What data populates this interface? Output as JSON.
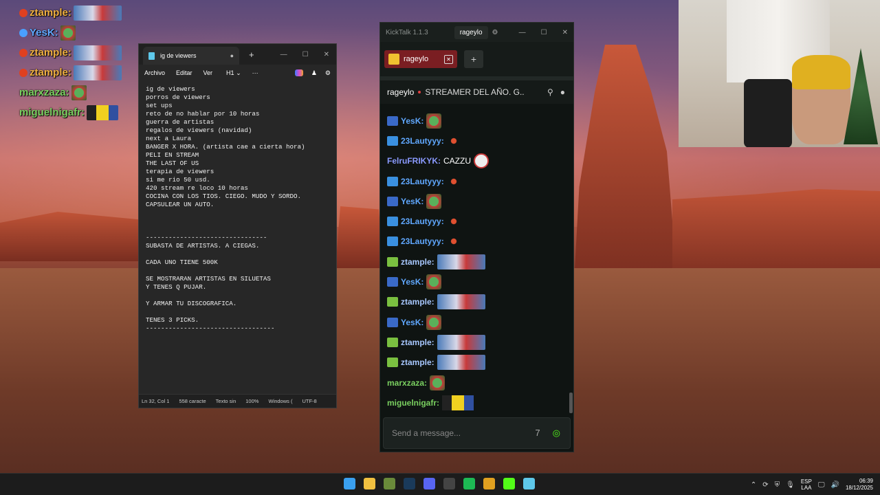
{
  "overlay_chat": [
    {
      "name": "ztample:",
      "color": "#f0b040",
      "badge": "#e04020",
      "emote": "wide"
    },
    {
      "name": "YesK:",
      "color": "#60a8ff",
      "badge": "#4aa0ff",
      "emote": "small"
    },
    {
      "name": "ztample:",
      "color": "#f0b040",
      "badge": "#e04020",
      "emote": "wide"
    },
    {
      "name": "ztample:",
      "color": "#f0b040",
      "badge": "#e04020",
      "emote": "wide"
    },
    {
      "name": "marxzaza:",
      "color": "#7ad060",
      "badge": "",
      "emote": "small"
    },
    {
      "name": "miguelnigafr:",
      "color": "#7ad060",
      "badge": "",
      "emote": "minion"
    }
  ],
  "notepad": {
    "tab_title": "ig de viewers",
    "menu": [
      "Archivo",
      "Editar",
      "Ver"
    ],
    "heading_select": "H1",
    "more": "···",
    "content": "ig de viewers\nporros de viewers\nset ups\nreto de no hablar por 10 horas\nguerra de artistas\nregalos de viewers (navidad)\nnext a Laura\nBANGER X HORA. (artista cae a cierta hora)\nPELI EN STREAM\nTHE LAST OF US\nterapia de viewers\nsi me rio 50 usd.\n420 stream re loco 10 horas\nCOCINA CON LOS TIOS. CIEGO. MUDO Y SORDO.\nCAPSULEAR UN AUTO.\n\n\n\n--------------------------------\nSUBASTA DE ARTISTAS. A CIEGAS.\n\nCADA UNO TIENE 500K\n\nSE MOSTRARAN ARTISTAS EN SILUETAS\nY TENES Q PUJAR.\n\nY ARMAR TU DISCOGRAFICA.\n\nTENES 3 PICKS.\n----------------------------------",
    "status": {
      "position": "Ln 32, Col 1",
      "chars": "558 caracte",
      "format": "Texto sin",
      "zoom": "100%",
      "eol": "Windows (",
      "encoding": "UTF-8"
    }
  },
  "kicktalk": {
    "app_title": "KickTalk 1.1.3",
    "user": "rageylo",
    "tab_label": "rageylo",
    "stream_channel": "rageylo",
    "stream_title": "STREAMER DEL AÑO. G...",
    "input_placeholder": "Send a message...",
    "messages": [
      {
        "name": "YesK:",
        "color": "#60a8ff",
        "badge": "#3a6ac8",
        "text": "",
        "emote": "pepe"
      },
      {
        "name": "23Lautyyy:",
        "color": "#60a8ff",
        "badge": "#3a90e0",
        "text": "",
        "emote": "dot"
      },
      {
        "name": "FelruFRIKYK:",
        "color": "#8a9aff",
        "badge": "",
        "text": "CAZZU",
        "emote": "ghost"
      },
      {
        "name": "23Lautyyy:",
        "color": "#60a8ff",
        "badge": "#3a90e0",
        "text": "",
        "emote": "dot"
      },
      {
        "name": "YesK:",
        "color": "#60a8ff",
        "badge": "#3a6ac8",
        "text": "",
        "emote": "pepe"
      },
      {
        "name": "23Lautyyy:",
        "color": "#60a8ff",
        "badge": "#3a90e0",
        "text": "",
        "emote": "dot"
      },
      {
        "name": "23Lautyyy:",
        "color": "#60a8ff",
        "badge": "#3a90e0",
        "text": "",
        "emote": "dot"
      },
      {
        "name": "ztample:",
        "color": "#a8c8ff",
        "badge": "#7ac040",
        "text": "",
        "emote": "wide"
      },
      {
        "name": "YesK:",
        "color": "#60a8ff",
        "badge": "#3a6ac8",
        "text": "",
        "emote": "pepe"
      },
      {
        "name": "ztample:",
        "color": "#a8c8ff",
        "badge": "#7ac040",
        "text": "",
        "emote": "wide"
      },
      {
        "name": "YesK:",
        "color": "#60a8ff",
        "badge": "#3a6ac8",
        "text": "",
        "emote": "pepe"
      },
      {
        "name": "ztample:",
        "color": "#a8c8ff",
        "badge": "#7ac040",
        "text": "",
        "emote": "wide"
      },
      {
        "name": "ztample:",
        "color": "#a8c8ff",
        "badge": "#7ac040",
        "text": "",
        "emote": "wide"
      },
      {
        "name": "marxzaza:",
        "color": "#7ad060",
        "badge": "",
        "text": "",
        "emote": "pepe"
      },
      {
        "name": "miguelnigafr:",
        "color": "#7ad060",
        "badge": "",
        "text": "",
        "emote": "minion"
      }
    ]
  },
  "taskbar": {
    "lang_top": "ESP",
    "lang_bottom": "LAA",
    "time": "06:39",
    "date": "18/12/2025",
    "apps": [
      {
        "name": "start-icon",
        "color": "#3aa0f0"
      },
      {
        "name": "file-explorer-icon",
        "color": "#f0c040"
      },
      {
        "name": "gamepad-app-icon",
        "color": "#6a8a3a"
      },
      {
        "name": "steam-icon",
        "color": "#1a3a5a"
      },
      {
        "name": "discord-icon",
        "color": "#5865f2"
      },
      {
        "name": "obs-icon",
        "color": "#444"
      },
      {
        "name": "spotify-icon",
        "color": "#1db954"
      },
      {
        "name": "chrome-icon",
        "color": "#e0a020"
      },
      {
        "name": "kick-icon",
        "color": "#53fc18"
      },
      {
        "name": "notepad-icon",
        "color": "#5ec8ea"
      }
    ]
  }
}
